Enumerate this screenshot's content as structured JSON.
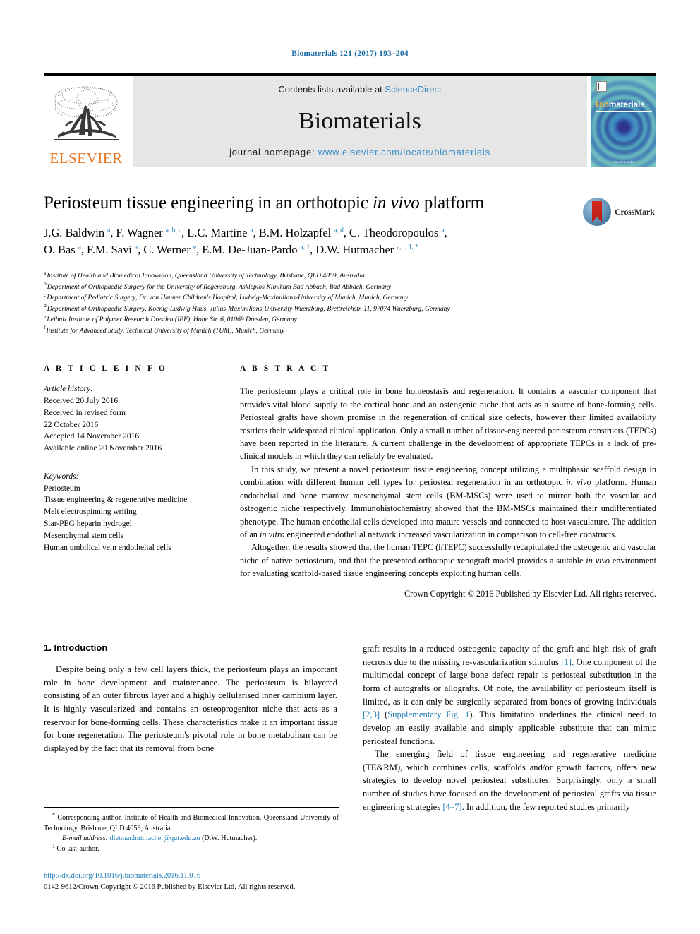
{
  "running_head": "Biomaterials 121 (2017) 193–204",
  "masthead": {
    "publisher_logo_text": "ELSEVIER",
    "contents_prefix": "Contents lists available at ",
    "contents_link": "ScienceDirect",
    "journal_name": "Biomaterials",
    "homepage_prefix": "journal homepage: ",
    "homepage_url": "www.elsevier.com/locate/biomaterials",
    "cover": {
      "title_part1": "Bio",
      "title_part2": "materials",
      "footer": "Elsevier\nLondon"
    },
    "accent_color": "#3c8dc5",
    "elsevier_orange": "#e87722"
  },
  "article": {
    "title_before_italic": "Periosteum tissue engineering in an orthotopic ",
    "title_italic": "in vivo",
    "title_after_italic": " platform",
    "crossmark_label": "CrossMark",
    "authors_line1": "J.G. Baldwin <sup>a</sup>, F. Wagner <sup>a, b, c</sup>, L.C. Martine <sup>a</sup>, B.M. Holzapfel <sup>a, d</sup>, C. Theodoropoulos <sup>a</sup>,",
    "authors_line2": "O. Bas <sup>a</sup>, F.M. Savi <sup>a</sup>, C. Werner <sup>e</sup>, E.M. De-Juan-Pardo <sup>a, 1</sup>, D.W. Hutmacher <sup>a, f, 1, *</sup>",
    "affiliations": [
      {
        "marker": "a",
        "text": "Institute of Health and Biomedical Innovation, Queensland University of Technology, Brisbane, QLD 4059, Australia"
      },
      {
        "marker": "b",
        "text": "Department of Orthopaedic Surgery for the University of Regensburg, Asklepios Klinikum Bad Abbach, Bad Abbach, Germany"
      },
      {
        "marker": "c",
        "text": "Department of Pediatric Surgery, Dr. von Hauner Children's Hospital, Ludwig-Maximilians-University of Munich, Munich, Germany"
      },
      {
        "marker": "d",
        "text": "Department of Orthopaedic Surgery, Koenig-Ludwig Haus, Julius-Maximilians-University Wuerzburg, Brettreichstr. 11, 97074 Wuerzburg, Germany"
      },
      {
        "marker": "e",
        "text": "Leibniz Institute of Polymer Research Dresden (IPF), Hohe Str. 6, 01069 Dresden, Germany"
      },
      {
        "marker": "f",
        "text": "Institute for Advanced Study, Technical University of Munich (TUM), Munich, Germany"
      }
    ]
  },
  "article_info": {
    "heading": "A R T I C L E   I N F O",
    "history_label": "Article history:",
    "history": [
      "Received 20 July 2016",
      "Received in revised form",
      "22 October 2016",
      "Accepted 14 November 2016",
      "Available online 20 November 2016"
    ],
    "keywords_label": "Keywords:",
    "keywords": [
      "Periosteum",
      "Tissue engineering & regenerative medicine",
      "Melt electrospinning writing",
      "Star-PEG heparin hydrogel",
      "Mesenchymal stem cells",
      "Human umbilical vein endothelial cells"
    ]
  },
  "abstract": {
    "heading": "A B S T R A C T",
    "paragraph1": "The periosteum plays a critical role in bone homeostasis and regeneration. It contains a vascular component that provides vital blood supply to the cortical bone and an osteogenic niche that acts as a source of bone-forming cells. Periosteal grafts have shown promise in the regeneration of critical size defects, however their limited availability restricts their widespread clinical application. Only a small number of tissue-engineered periosteum constructs (TEPCs) have been reported in the literature. A current challenge in the development of appropriate TEPCs is a lack of pre-clinical models in which they can reliably be evaluated.",
    "paragraph2_a": "In this study, we present a novel periosteum tissue engineering concept utilizing a multiphasic scaffold design in combination with different human cell types for periosteal regeneration in an orthotopic ",
    "paragraph2_i1": "in vivo",
    "paragraph2_b": " platform. Human endothelial and bone marrow mesenchymal stem cells (BM-MSCs) were used to mirror both the vascular and osteogenic niche respectively. Immunohistochemistry showed that the BM-MSCs maintained their undifferentiated phenotype. The human endothelial cells developed into mature vessels and connected to host vasculature. The addition of an ",
    "paragraph2_i2": "in vitro",
    "paragraph2_c": " engineered endothelial network increased vascularization in comparison to cell-free constructs.",
    "paragraph3_a": "Altogether, the results showed that the human TEPC (hTEPC) successfully recapitulated the osteogenic and vascular niche of native periosteum, and that the presented orthotopic xenograft model provides a suitable ",
    "paragraph3_i1": "in vivo",
    "paragraph3_b": " environment for evaluating scaffold-based tissue engineering concepts exploiting human cells.",
    "copyright": "Crown Copyright © 2016 Published by Elsevier Ltd. All rights reserved."
  },
  "body": {
    "section_heading": "1. Introduction",
    "left_paragraph": "Despite being only a few cell layers thick, the periosteum plays an important role in bone development and maintenance. The periosteum is bilayered consisting of an outer fibrous layer and a highly cellularised inner cambium layer. It is highly vascularized and contains an osteoprogenitor niche that acts as a reservoir for bone-forming cells. These characteristics make it an important tissue for bone regeneration. The periosteum's pivotal role in bone metabolism can be displayed by the fact that its removal from bone",
    "right_p1_a": "graft results in a reduced osteogenic capacity of the graft and high risk of graft necrosis due to the missing re-vascularization stimulus ",
    "right_p1_ref1": "[1]",
    "right_p1_b": ". One component of the multimodal concept of large bone defect repair is periosteal substitution in the form of autografts or allografts. Of note, the availability of periosteum itself is limited, as it can only be surgically separated from bones of growing individuals ",
    "right_p1_ref2": "[2,3]",
    "right_p1_c": " (",
    "right_p1_ref3": "Supplementary Fig. 1",
    "right_p1_d": "). This limitation underlines the clinical need to develop an easily available and simply applicable substitute that can mimic periosteal functions.",
    "right_p2_a": "The emerging field of tissue engineering and regenerative medicine (TE&RM), which combines cells, scaffolds and/or growth factors, offers new strategies to develop novel periosteal substitutes. Surprisingly, only a small number of studies have focused on the development of periosteal grafts via tissue engineering strategies ",
    "right_p2_ref1": "[4–7]",
    "right_p2_b": ". In addition, the few reported studies primarily"
  },
  "footnotes": {
    "corresponding_marker": "*",
    "corresponding_text": " Corresponding author. Institute of Health and Biomedical Innovation, Queensland University of Technology, Brisbane, QLD 4059, Australia.",
    "email_label": "E-mail address:",
    "email_value": "dietmar.hutmacher@qut.edu.au",
    "email_owner": " (D.W. Hutmacher).",
    "co_last_marker": "1",
    "co_last_text": " Co last-author."
  },
  "bottom": {
    "doi": "http://dx.doi.org/10.1016/j.biomaterials.2016.11.016",
    "issn_line": "0142-9612/Crown Copyright © 2016 Published by Elsevier Ltd. All rights reserved."
  }
}
